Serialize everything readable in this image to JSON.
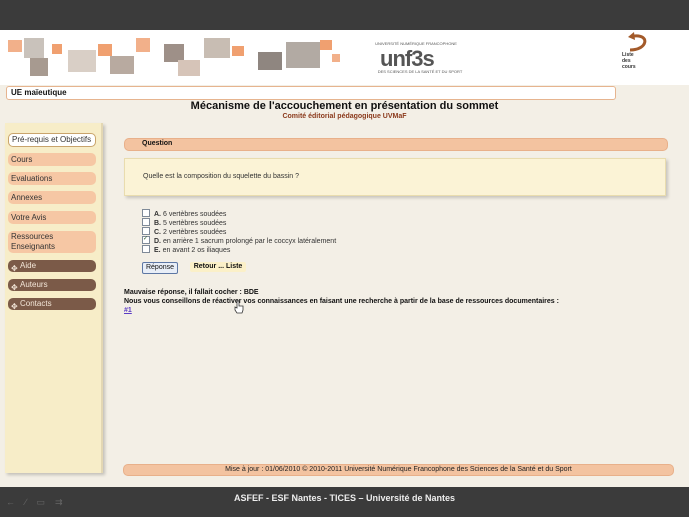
{
  "banner": {
    "logo_main": "unf3s",
    "logo_small_top": "UNIVERSITÉ NUMÉRIQUE FRANCOPHONE",
    "logo_small_bottom": "DES SCIENCES DE LA SANTÉ ET DU SPORT",
    "return_label_1": "Liste",
    "return_label_2": "des",
    "return_label_3": "cours"
  },
  "course": {
    "ue_label": "UE maïeutique"
  },
  "page": {
    "title": "Mécanisme de l'accouchement en présentation du sommet",
    "subtitle": "Comité éditorial pédagogique UVMaF"
  },
  "sidebar": {
    "items": [
      {
        "label": "Pré-requis et Objectifs"
      },
      {
        "label": "Cours"
      },
      {
        "label": "Evaluations"
      },
      {
        "label": "Annexes"
      },
      {
        "label": "Votre Avis"
      },
      {
        "label": "Ressources Enseignants"
      },
      {
        "label": "Aide"
      },
      {
        "label": "Auteurs"
      },
      {
        "label": "Contacts"
      }
    ]
  },
  "question": {
    "header": "Question",
    "text": "Quelle est la composition du squelette du bassin ?",
    "answers": [
      {
        "letter": "A.",
        "text": "6 vertèbres soudées",
        "checked": false
      },
      {
        "letter": "B.",
        "text": "5 vertèbres soudées",
        "checked": false
      },
      {
        "letter": "C.",
        "text": "2 vertèbres soudées",
        "checked": false
      },
      {
        "letter": "D.",
        "text": "en arrière 1 sacrum prolongé par le coccyx latéralement",
        "checked": true
      },
      {
        "letter": "E.",
        "text": "en avant 2 os iliaques",
        "checked": false
      }
    ],
    "response_button": "Réponse",
    "return_button": "Retour ... Liste"
  },
  "feedback": {
    "line1": "Mauvaise réponse, il fallait cocher : BDE",
    "line2": "Nous vous conseillons de réactiver vos connaissances en faisant une recherche à partir de la base de ressources documentaires :",
    "link": "#1"
  },
  "footer": {
    "text": "Mise à jour : 01/06/2010 © 2010-2011 Université Numérique Francophone des Sciences de la Santé et du Sport"
  },
  "bottom": {
    "text": "ASFEF - ESF Nantes - TICES – Université de Nantes"
  },
  "colors": {
    "accent": "#f3c3a0",
    "sidebar_bg": "#f7edc8",
    "dark_item": "#7b5a48"
  }
}
